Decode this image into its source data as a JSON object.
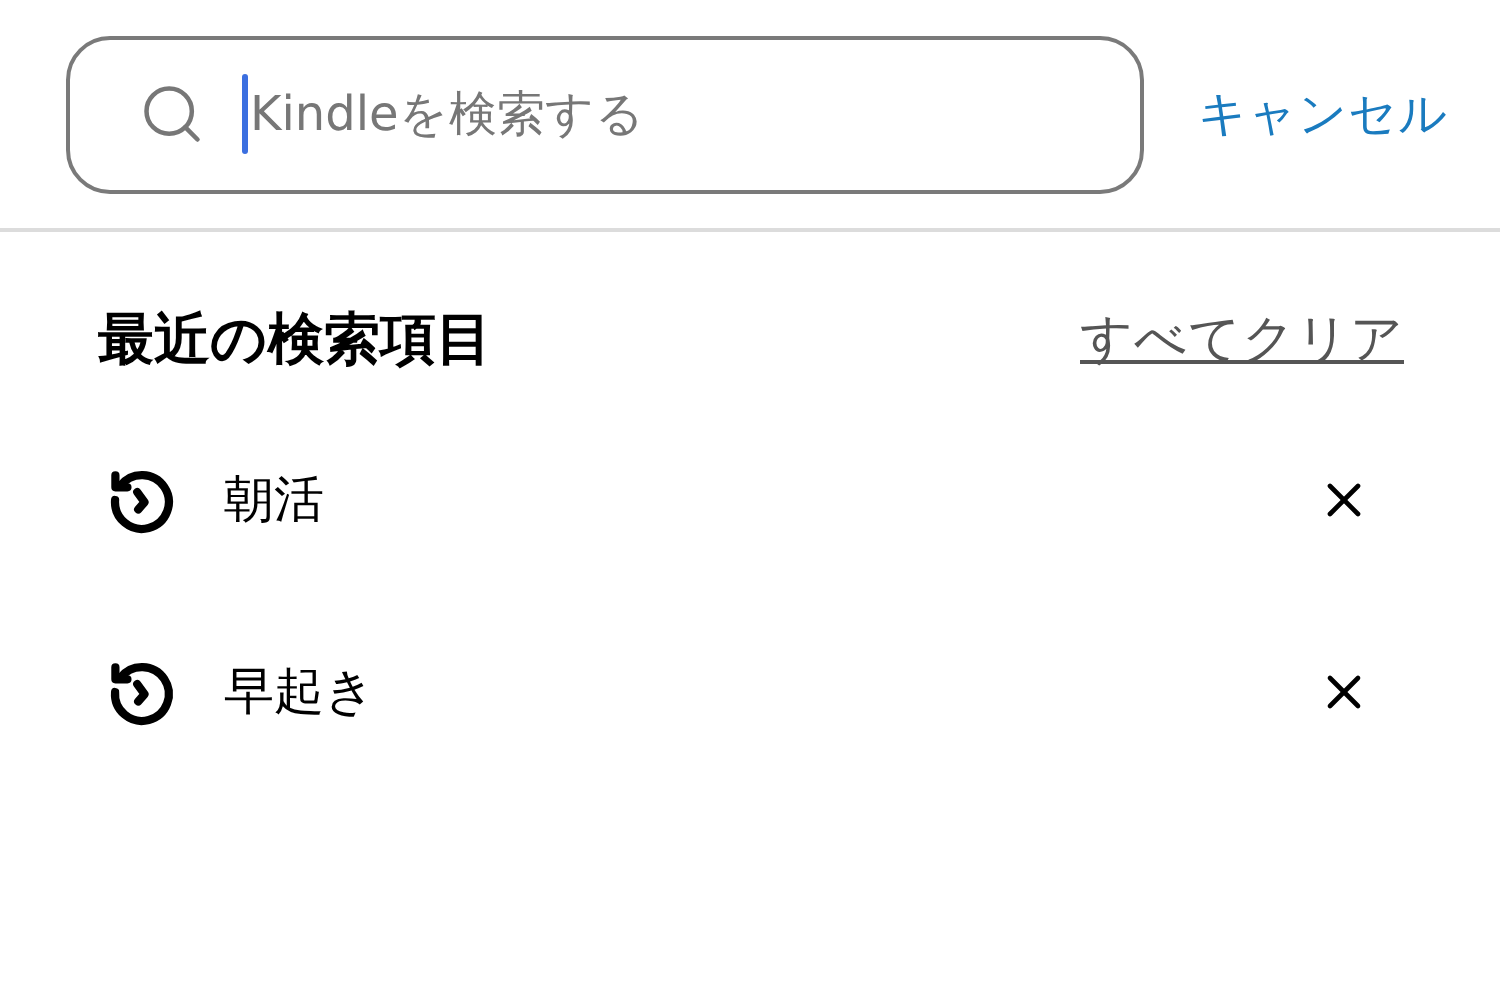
{
  "search": {
    "placeholder": "Kindleを検索する",
    "cancel": "キャンセル"
  },
  "recent": {
    "title": "最近の検索項目",
    "clear_all": "すべてクリア",
    "items": [
      {
        "label": "朝活"
      },
      {
        "label": "早起き"
      }
    ]
  }
}
